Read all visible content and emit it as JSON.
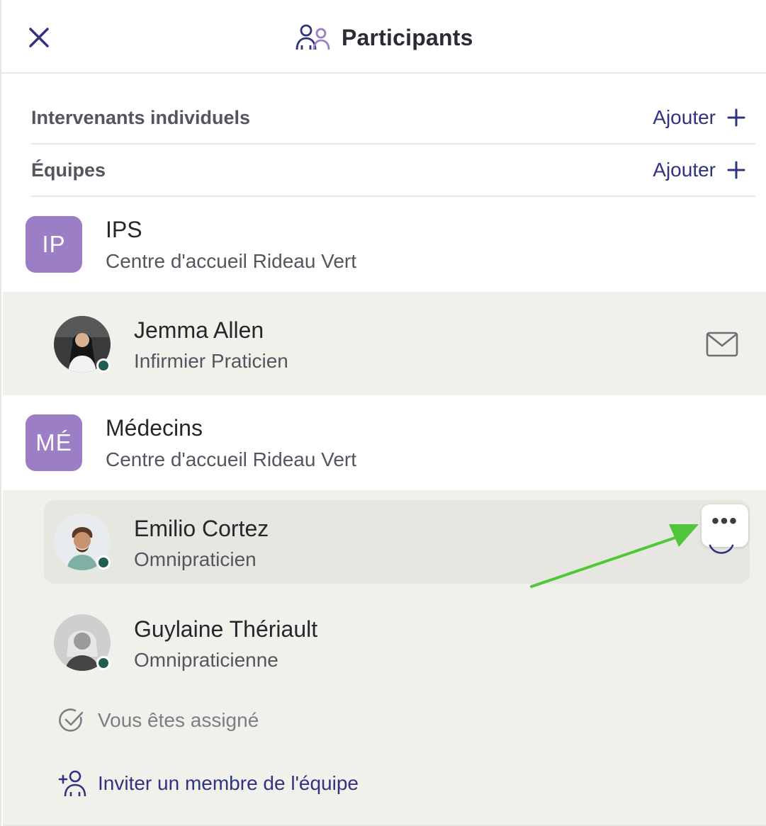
{
  "header": {
    "title": "Participants",
    "close_icon": "close-icon",
    "title_icon": "participants-icon"
  },
  "sections": {
    "individuals": {
      "label": "Intervenants individuels",
      "add_label": "Ajouter"
    },
    "teams": {
      "label": "Équipes",
      "add_label": "Ajouter"
    }
  },
  "teams": [
    {
      "initials": "IP",
      "name": "IPS",
      "org": "Centre d'accueil Rideau Vert",
      "members": [
        {
          "name": "Jemma Allen",
          "role": "Infirmier Praticien",
          "status": "online",
          "action_icon": "mail-icon"
        }
      ]
    },
    {
      "initials": "MÉ",
      "name": "Médecins",
      "org": "Centre d'accueil Rideau Vert",
      "members": [
        {
          "name": "Emilio Cortez",
          "role": "Omnipraticien",
          "status": "online",
          "action_icon": "more-icon",
          "highlighted": true
        },
        {
          "name": "Guylaine Thériault",
          "role": "Omnipraticienne",
          "status": "online"
        }
      ],
      "assigned_text": "Vous êtes assigné",
      "invite_text": "Inviter un membre de l'équipe"
    }
  ],
  "colors": {
    "team_avatar": "#9c7ec6",
    "link": "#2f3380",
    "presence": "#1f5e52",
    "annotation_arrow": "#52c63a",
    "member_bg": "#f1f1ec"
  }
}
